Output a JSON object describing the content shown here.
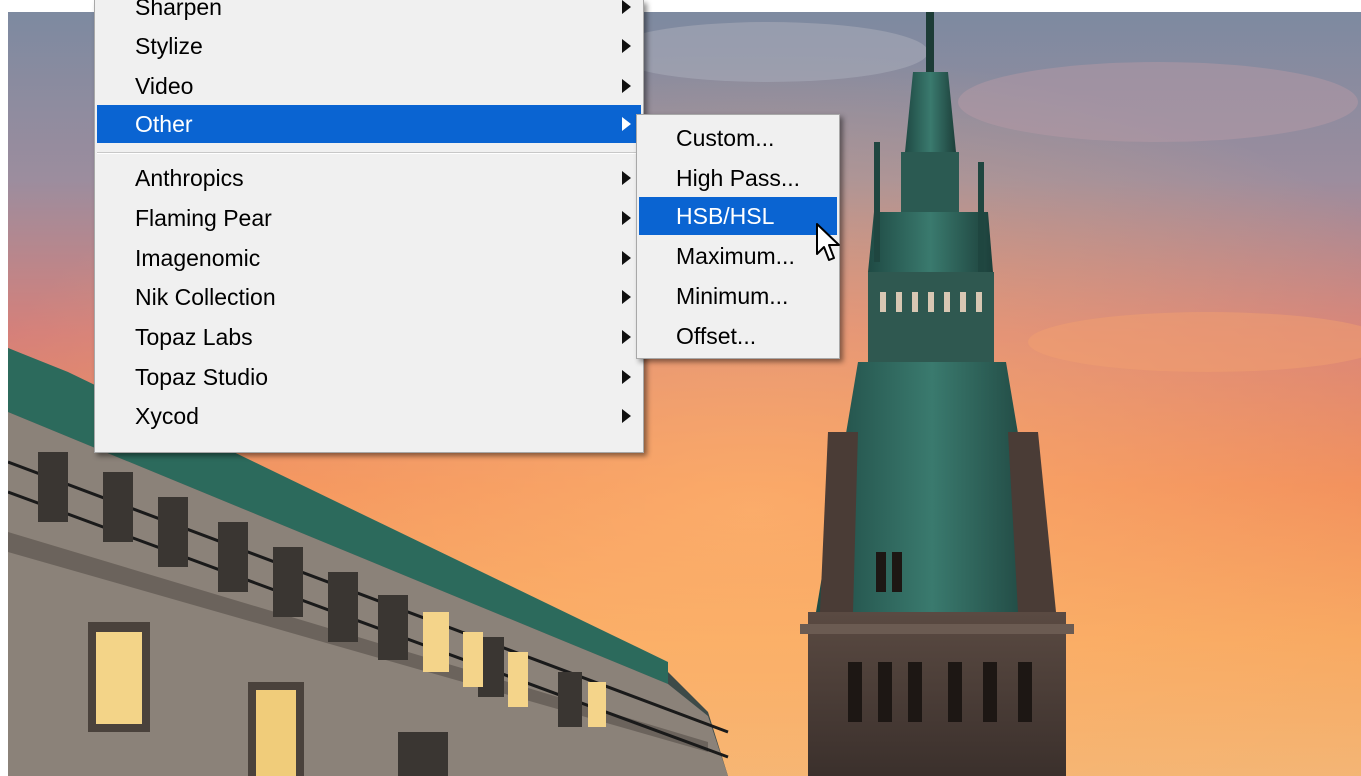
{
  "menu": {
    "items": [
      {
        "label": "Sharpen",
        "has_submenu": true
      },
      {
        "label": "Stylize",
        "has_submenu": true
      },
      {
        "label": "Video",
        "has_submenu": true
      },
      {
        "label": "Other",
        "has_submenu": true,
        "highlighted": true
      },
      {
        "label": "Anthropics",
        "has_submenu": true
      },
      {
        "label": "Flaming Pear",
        "has_submenu": true
      },
      {
        "label": "Imagenomic",
        "has_submenu": true
      },
      {
        "label": "Nik Collection",
        "has_submenu": true
      },
      {
        "label": "Topaz Labs",
        "has_submenu": true
      },
      {
        "label": "Topaz Studio",
        "has_submenu": true
      },
      {
        "label": "Xycod",
        "has_submenu": true
      }
    ]
  },
  "submenu": {
    "items": [
      {
        "label": "Custom..."
      },
      {
        "label": "High Pass..."
      },
      {
        "label": "HSB/HSL",
        "highlighted": true
      },
      {
        "label": "Maximum..."
      },
      {
        "label": "Minimum..."
      },
      {
        "label": "Offset..."
      }
    ]
  },
  "colors": {
    "menu_bg": "#f0f0f0",
    "highlight": "#0a64d2",
    "highlight_text": "#ffffff"
  },
  "icons": {
    "submenu_arrow": "triangle-right-icon",
    "cursor": "mouse-pointer-icon"
  }
}
